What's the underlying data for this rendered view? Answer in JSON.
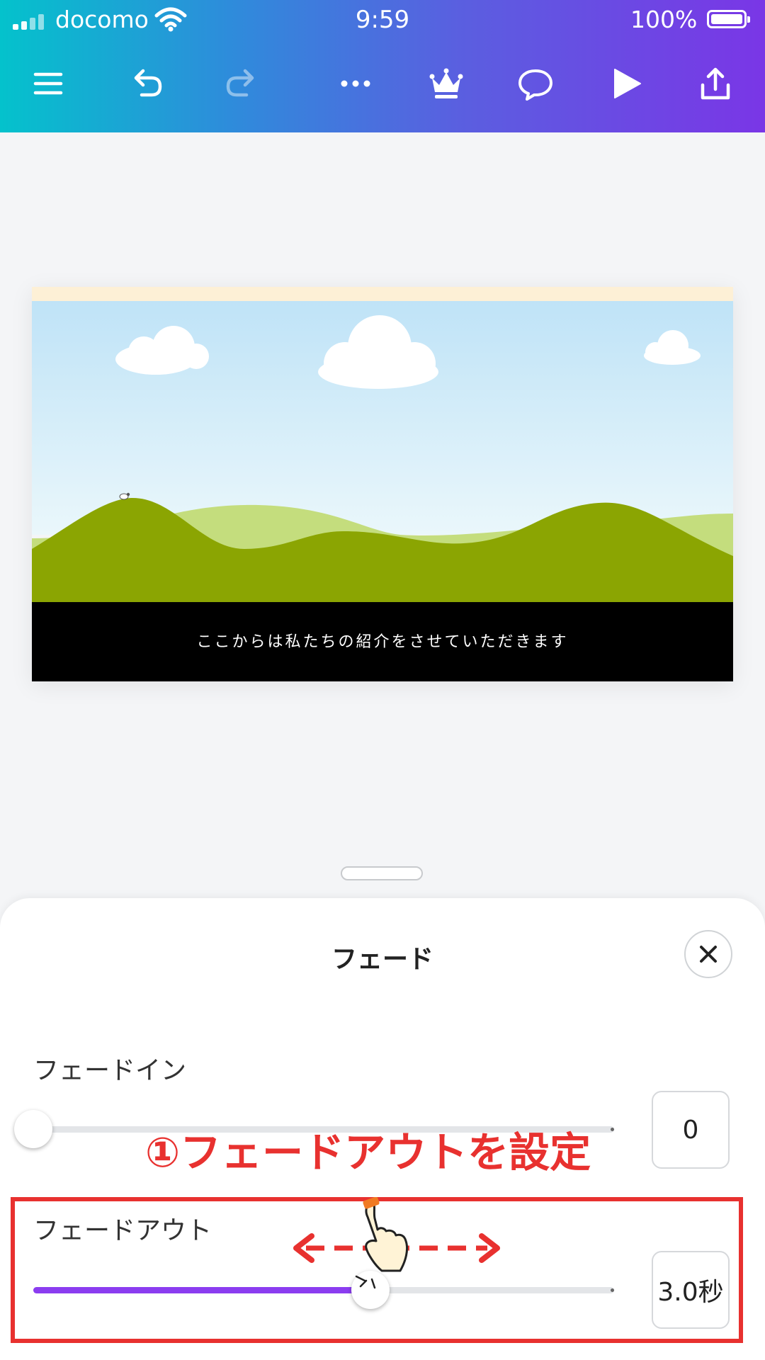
{
  "status_bar": {
    "carrier": "docomo",
    "time": "9:59",
    "battery": "100%"
  },
  "toolbar": {
    "icons": [
      "menu-icon",
      "undo-icon",
      "redo-icon",
      "more-icon",
      "crown-icon",
      "comment-icon",
      "play-icon",
      "share-icon"
    ]
  },
  "slide": {
    "caption": "ここからは私たちの紹介をさせていただきます"
  },
  "sheet": {
    "title": "フェード",
    "fade_in": {
      "label": "フェードイン",
      "value": "0",
      "level": 0
    },
    "fade_out": {
      "label": "フェードアウト",
      "value": "3.0秒",
      "level": 0.58
    }
  },
  "annotation": {
    "text": "①フェードアウトを設定"
  },
  "colors": {
    "accent": "#8b3df0",
    "annotation": "#e8312f"
  }
}
